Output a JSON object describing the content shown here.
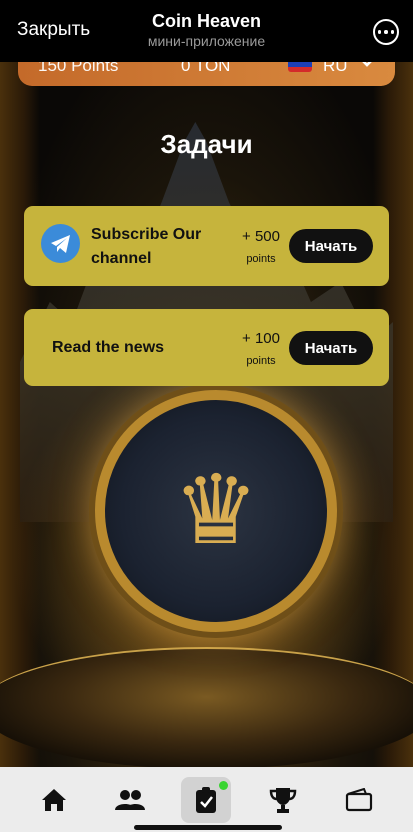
{
  "app": {
    "close_label": "Закрыть",
    "title": "Coin Heaven",
    "subtitle": "мини-приложение",
    "more_icon": "more-icon"
  },
  "status": {
    "points": "150 Points",
    "ton": "0 TON",
    "lang": "RU",
    "flag_colors": [
      "#ffffff",
      "#1c3fb6",
      "#d42a2a"
    ]
  },
  "page": {
    "title": "Задачи"
  },
  "tasks": [
    {
      "title": "Subscribe Our channel",
      "reward": "+ 500",
      "reward_unit": "points",
      "button": "Начать",
      "icon": "telegram-icon"
    },
    {
      "title": "Read the news",
      "reward": "+ 100",
      "reward_unit": "points",
      "button": "Начать"
    }
  ],
  "tabs": [
    {
      "name": "home",
      "icon": "home-icon"
    },
    {
      "name": "friends",
      "icon": "friends-icon"
    },
    {
      "name": "tasks",
      "icon": "tasks-icon",
      "active": true,
      "badge_color": "#38d431"
    },
    {
      "name": "leaderboard",
      "icon": "trophy-icon"
    },
    {
      "name": "wallet",
      "icon": "wallet-icon"
    }
  ],
  "colors": {
    "card": "#c6b43c",
    "button": "#111111",
    "header_strip": "#d07a35",
    "telegram": "#3b8bd9"
  }
}
